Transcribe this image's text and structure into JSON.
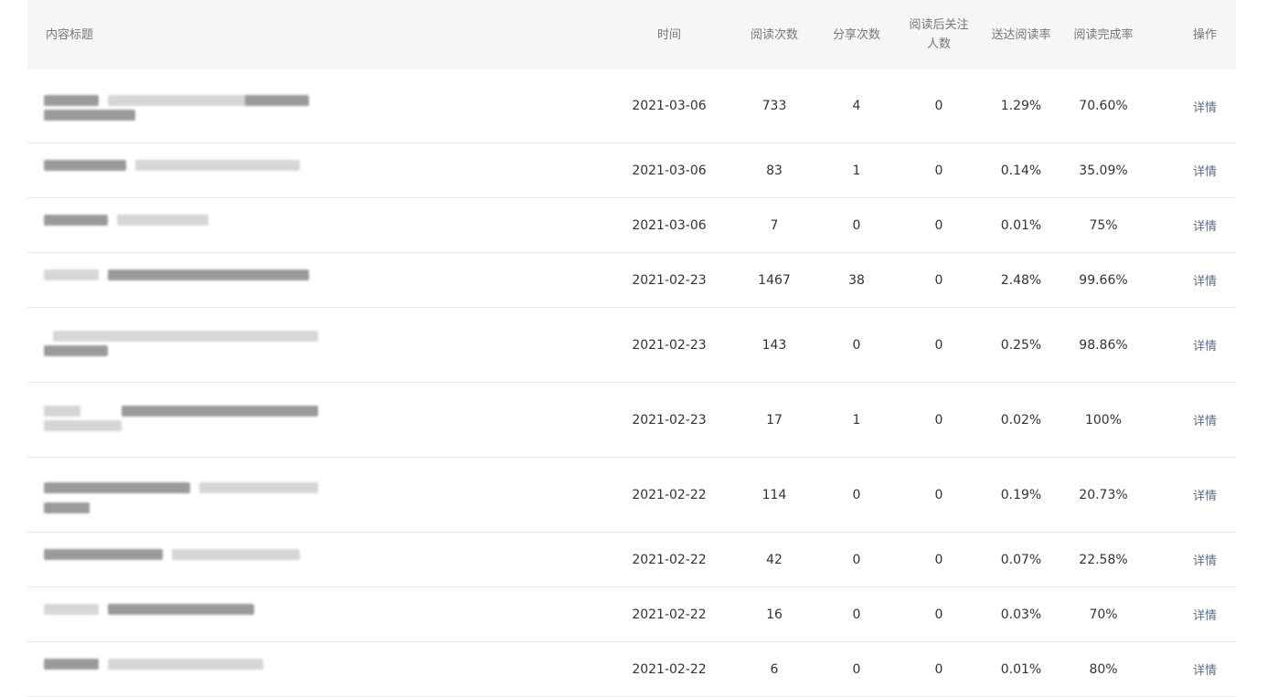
{
  "headers": {
    "title": "内容标题",
    "time": "时间",
    "reads": "阅读次数",
    "shares": "分享次数",
    "follows_line1": "阅读后关注",
    "follows_line2": "人数",
    "reach_rate": "送达阅读率",
    "complete_rate": "阅读完成率",
    "action": "操作"
  },
  "rows": [
    {
      "time": "2021-03-06",
      "reads": "733",
      "shares": "4",
      "follows": "0",
      "reach": "1.29%",
      "complete": "70.60%",
      "action": "详情"
    },
    {
      "time": "2021-03-06",
      "reads": "83",
      "shares": "1",
      "follows": "0",
      "reach": "0.14%",
      "complete": "35.09%",
      "action": "详情"
    },
    {
      "time": "2021-03-06",
      "reads": "7",
      "shares": "0",
      "follows": "0",
      "reach": "0.01%",
      "complete": "75%",
      "action": "详情"
    },
    {
      "time": "2021-02-23",
      "reads": "1467",
      "shares": "38",
      "follows": "0",
      "reach": "2.48%",
      "complete": "99.66%",
      "action": "详情"
    },
    {
      "time": "2021-02-23",
      "reads": "143",
      "shares": "0",
      "follows": "0",
      "reach": "0.25%",
      "complete": "98.86%",
      "action": "详情"
    },
    {
      "time": "2021-02-23",
      "reads": "17",
      "shares": "1",
      "follows": "0",
      "reach": "0.02%",
      "complete": "100%",
      "action": "详情"
    },
    {
      "time": "2021-02-22",
      "reads": "114",
      "shares": "0",
      "follows": "0",
      "reach": "0.19%",
      "complete": "20.73%",
      "action": "详情"
    },
    {
      "time": "2021-02-22",
      "reads": "42",
      "shares": "0",
      "follows": "0",
      "reach": "0.07%",
      "complete": "22.58%",
      "action": "详情"
    },
    {
      "time": "2021-02-22",
      "reads": "16",
      "shares": "0",
      "follows": "0",
      "reach": "0.03%",
      "complete": "70%",
      "action": "详情"
    },
    {
      "time": "2021-02-22",
      "reads": "6",
      "shares": "0",
      "follows": "0",
      "reach": "0.01%",
      "complete": "80%",
      "action": "详情"
    }
  ],
  "colors": {
    "header_bg": "#f5f6f7",
    "border": "#e8e8e8",
    "action_link": "#5b6b8c",
    "blur_dark": "#9a9a9a",
    "blur_light": "#d6d6d6"
  }
}
